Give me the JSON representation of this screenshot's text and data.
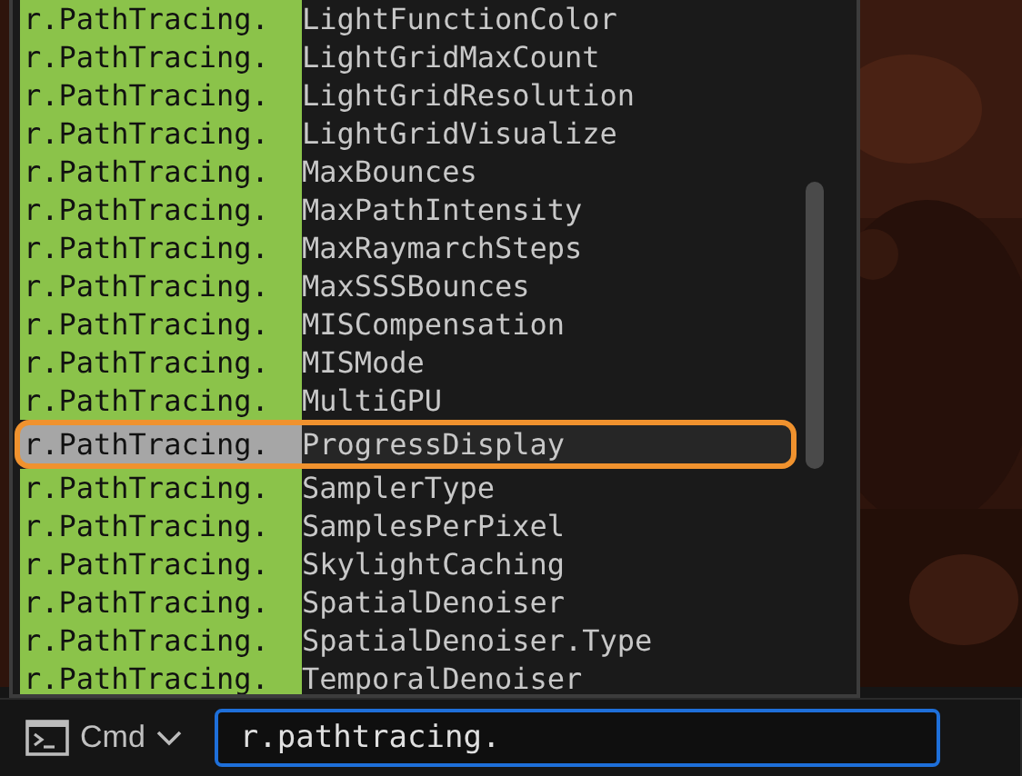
{
  "suggestions": [
    {
      "prefix": "r.PathTracing.",
      "name": "LightFunctionColor",
      "selected": false
    },
    {
      "prefix": "r.PathTracing.",
      "name": "LightGridMaxCount",
      "selected": false
    },
    {
      "prefix": "r.PathTracing.",
      "name": "LightGridResolution",
      "selected": false
    },
    {
      "prefix": "r.PathTracing.",
      "name": "LightGridVisualize",
      "selected": false
    },
    {
      "prefix": "r.PathTracing.",
      "name": "MaxBounces",
      "selected": false
    },
    {
      "prefix": "r.PathTracing.",
      "name": "MaxPathIntensity",
      "selected": false
    },
    {
      "prefix": "r.PathTracing.",
      "name": "MaxRaymarchSteps",
      "selected": false
    },
    {
      "prefix": "r.PathTracing.",
      "name": "MaxSSSBounces",
      "selected": false
    },
    {
      "prefix": "r.PathTracing.",
      "name": "MISCompensation",
      "selected": false
    },
    {
      "prefix": "r.PathTracing.",
      "name": "MISMode",
      "selected": false
    },
    {
      "prefix": "r.PathTracing.",
      "name": "MultiGPU",
      "selected": false
    },
    {
      "prefix": "r.PathTracing.",
      "name": "ProgressDisplay",
      "selected": true
    },
    {
      "prefix": "r.PathTracing.",
      "name": "SamplerType",
      "selected": false
    },
    {
      "prefix": "r.PathTracing.",
      "name": "SamplesPerPixel",
      "selected": false
    },
    {
      "prefix": "r.PathTracing.",
      "name": "SkylightCaching",
      "selected": false
    },
    {
      "prefix": "r.PathTracing.",
      "name": "SpatialDenoiser",
      "selected": false
    },
    {
      "prefix": "r.PathTracing.",
      "name": "SpatialDenoiser.Type",
      "selected": false
    },
    {
      "prefix": "r.PathTracing.",
      "name": "TemporalDenoiser",
      "selected": false
    }
  ],
  "console": {
    "mode": "Cmd",
    "value": "r.pathtracing."
  }
}
